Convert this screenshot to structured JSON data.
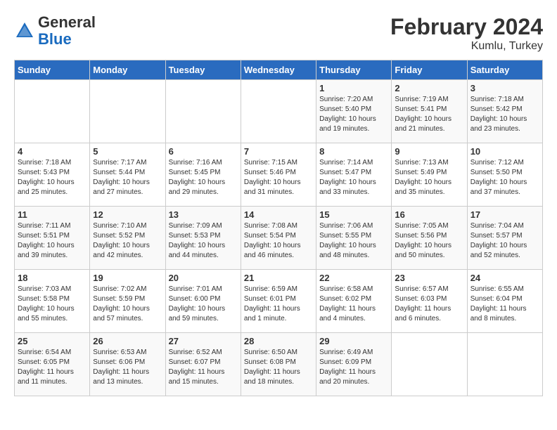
{
  "logo": {
    "general": "General",
    "blue": "Blue"
  },
  "title": "February 2024",
  "subtitle": "Kumlu, Turkey",
  "days_of_week": [
    "Sunday",
    "Monday",
    "Tuesday",
    "Wednesday",
    "Thursday",
    "Friday",
    "Saturday"
  ],
  "weeks": [
    [
      {
        "day": "",
        "details": ""
      },
      {
        "day": "",
        "details": ""
      },
      {
        "day": "",
        "details": ""
      },
      {
        "day": "",
        "details": ""
      },
      {
        "day": "1",
        "details": "Sunrise: 7:20 AM\nSunset: 5:40 PM\nDaylight: 10 hours\nand 19 minutes."
      },
      {
        "day": "2",
        "details": "Sunrise: 7:19 AM\nSunset: 5:41 PM\nDaylight: 10 hours\nand 21 minutes."
      },
      {
        "day": "3",
        "details": "Sunrise: 7:18 AM\nSunset: 5:42 PM\nDaylight: 10 hours\nand 23 minutes."
      }
    ],
    [
      {
        "day": "4",
        "details": "Sunrise: 7:18 AM\nSunset: 5:43 PM\nDaylight: 10 hours\nand 25 minutes."
      },
      {
        "day": "5",
        "details": "Sunrise: 7:17 AM\nSunset: 5:44 PM\nDaylight: 10 hours\nand 27 minutes."
      },
      {
        "day": "6",
        "details": "Sunrise: 7:16 AM\nSunset: 5:45 PM\nDaylight: 10 hours\nand 29 minutes."
      },
      {
        "day": "7",
        "details": "Sunrise: 7:15 AM\nSunset: 5:46 PM\nDaylight: 10 hours\nand 31 minutes."
      },
      {
        "day": "8",
        "details": "Sunrise: 7:14 AM\nSunset: 5:47 PM\nDaylight: 10 hours\nand 33 minutes."
      },
      {
        "day": "9",
        "details": "Sunrise: 7:13 AM\nSunset: 5:49 PM\nDaylight: 10 hours\nand 35 minutes."
      },
      {
        "day": "10",
        "details": "Sunrise: 7:12 AM\nSunset: 5:50 PM\nDaylight: 10 hours\nand 37 minutes."
      }
    ],
    [
      {
        "day": "11",
        "details": "Sunrise: 7:11 AM\nSunset: 5:51 PM\nDaylight: 10 hours\nand 39 minutes."
      },
      {
        "day": "12",
        "details": "Sunrise: 7:10 AM\nSunset: 5:52 PM\nDaylight: 10 hours\nand 42 minutes."
      },
      {
        "day": "13",
        "details": "Sunrise: 7:09 AM\nSunset: 5:53 PM\nDaylight: 10 hours\nand 44 minutes."
      },
      {
        "day": "14",
        "details": "Sunrise: 7:08 AM\nSunset: 5:54 PM\nDaylight: 10 hours\nand 46 minutes."
      },
      {
        "day": "15",
        "details": "Sunrise: 7:06 AM\nSunset: 5:55 PM\nDaylight: 10 hours\nand 48 minutes."
      },
      {
        "day": "16",
        "details": "Sunrise: 7:05 AM\nSunset: 5:56 PM\nDaylight: 10 hours\nand 50 minutes."
      },
      {
        "day": "17",
        "details": "Sunrise: 7:04 AM\nSunset: 5:57 PM\nDaylight: 10 hours\nand 52 minutes."
      }
    ],
    [
      {
        "day": "18",
        "details": "Sunrise: 7:03 AM\nSunset: 5:58 PM\nDaylight: 10 hours\nand 55 minutes."
      },
      {
        "day": "19",
        "details": "Sunrise: 7:02 AM\nSunset: 5:59 PM\nDaylight: 10 hours\nand 57 minutes."
      },
      {
        "day": "20",
        "details": "Sunrise: 7:01 AM\nSunset: 6:00 PM\nDaylight: 10 hours\nand 59 minutes."
      },
      {
        "day": "21",
        "details": "Sunrise: 6:59 AM\nSunset: 6:01 PM\nDaylight: 11 hours\nand 1 minute."
      },
      {
        "day": "22",
        "details": "Sunrise: 6:58 AM\nSunset: 6:02 PM\nDaylight: 11 hours\nand 4 minutes."
      },
      {
        "day": "23",
        "details": "Sunrise: 6:57 AM\nSunset: 6:03 PM\nDaylight: 11 hours\nand 6 minutes."
      },
      {
        "day": "24",
        "details": "Sunrise: 6:55 AM\nSunset: 6:04 PM\nDaylight: 11 hours\nand 8 minutes."
      }
    ],
    [
      {
        "day": "25",
        "details": "Sunrise: 6:54 AM\nSunset: 6:05 PM\nDaylight: 11 hours\nand 11 minutes."
      },
      {
        "day": "26",
        "details": "Sunrise: 6:53 AM\nSunset: 6:06 PM\nDaylight: 11 hours\nand 13 minutes."
      },
      {
        "day": "27",
        "details": "Sunrise: 6:52 AM\nSunset: 6:07 PM\nDaylight: 11 hours\nand 15 minutes."
      },
      {
        "day": "28",
        "details": "Sunrise: 6:50 AM\nSunset: 6:08 PM\nDaylight: 11 hours\nand 18 minutes."
      },
      {
        "day": "29",
        "details": "Sunrise: 6:49 AM\nSunset: 6:09 PM\nDaylight: 11 hours\nand 20 minutes."
      },
      {
        "day": "",
        "details": ""
      },
      {
        "day": "",
        "details": ""
      }
    ]
  ]
}
